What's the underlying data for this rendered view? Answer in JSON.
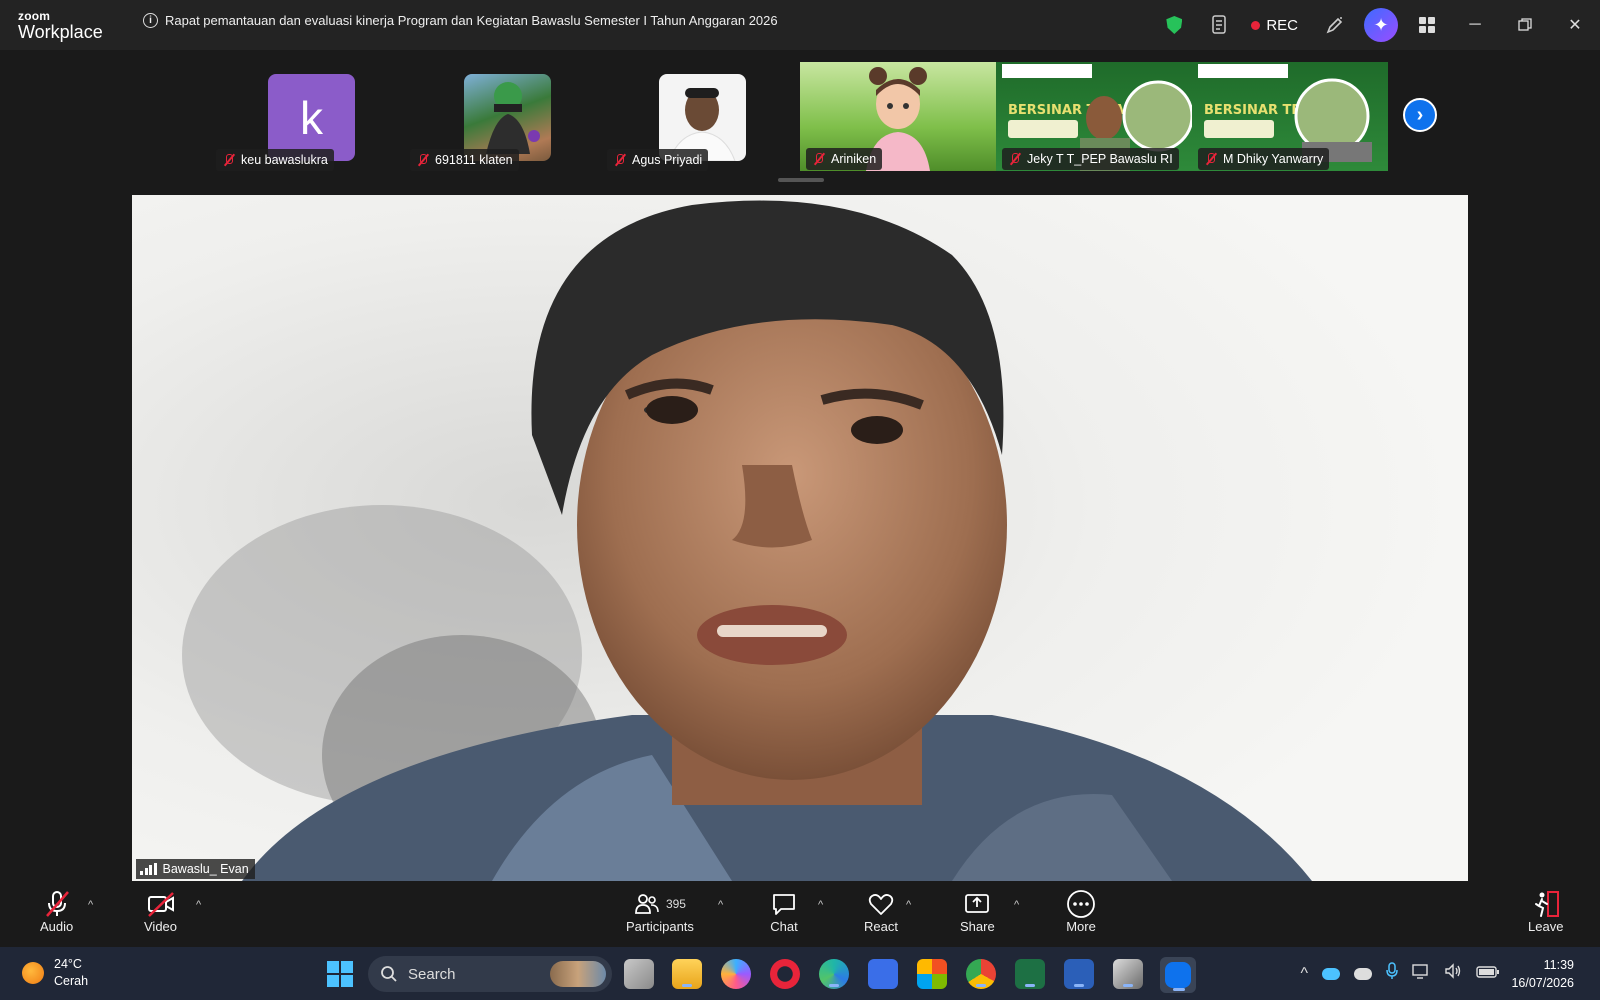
{
  "app": {
    "logo_line1": "zoom",
    "logo_line2": "Workplace"
  },
  "meeting": {
    "title": "Rapat pemantauan dan evaluasi kinerja Program dan Kegiatan Bawaslu Semester I Tahun Anggaran 2026",
    "rec_label": "REC"
  },
  "participants_strip": [
    {
      "name": "keu bawaslukra",
      "avatar_type": "letter",
      "letter": "k",
      "color": "#8b5cc9"
    },
    {
      "name": "691811 klaten",
      "avatar_type": "image"
    },
    {
      "name": "Agus Priyadi",
      "avatar_type": "image"
    }
  ],
  "video_tiles": [
    {
      "name": "Ariniken"
    },
    {
      "name": "Jeky T T_PEP Bawaslu RI",
      "banner_text": "BERSINAR TERANG"
    },
    {
      "name": "M Dhiky Yanwarry",
      "banner_text": "BERSINAR TERANG"
    }
  ],
  "speaker": {
    "name": "Bawaslu_ Evan"
  },
  "toolbar": {
    "audio": "Audio",
    "video": "Video",
    "participants": "Participants",
    "participants_count": "395",
    "chat": "Chat",
    "react": "React",
    "share": "Share",
    "more": "More",
    "leave": "Leave"
  },
  "taskbar": {
    "temperature": "24°C",
    "weather": "Cerah",
    "search_placeholder": "Search",
    "time": "11:39",
    "date": "16/07/2026"
  },
  "colors": {
    "accent": "#0e72ed",
    "rec": "#e8243a",
    "mute": "#e8243a",
    "shield": "#27c25a"
  }
}
